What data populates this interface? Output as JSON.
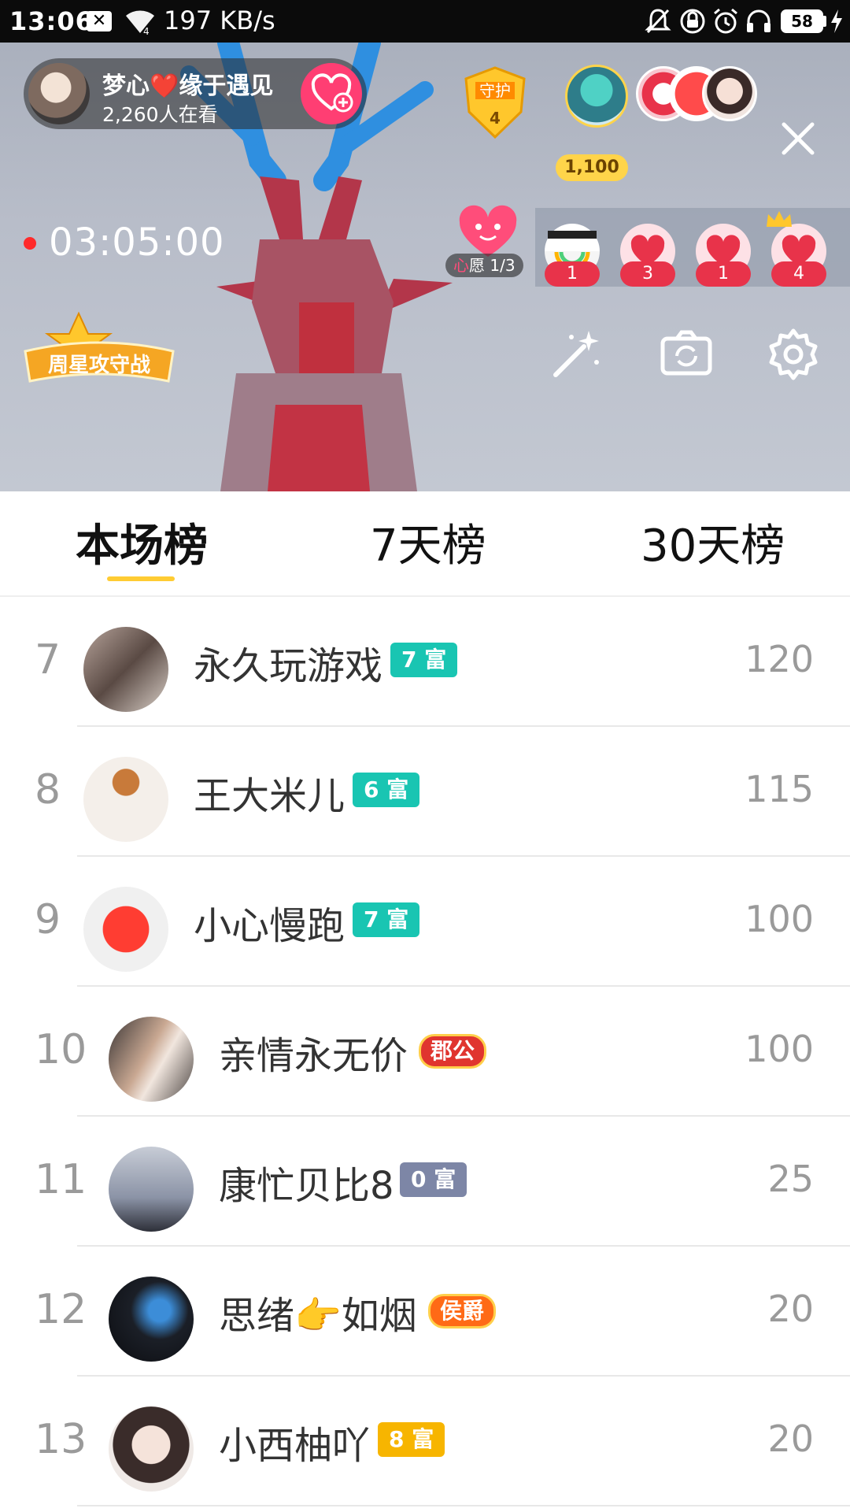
{
  "status_bar": {
    "time": "13:06",
    "notification_badge": "✕",
    "net_speed": "197 KB/s",
    "battery": "58",
    "icons": [
      "mute-icon",
      "lock-rotation-icon",
      "alarm-icon",
      "headset-icon",
      "charging-icon"
    ]
  },
  "live": {
    "host_name": "梦心❤️缘于遇见",
    "viewers": "2,260人在看",
    "guard_label": "守护",
    "guard_count": "4",
    "coins": "1,100",
    "duration": "03:05:00",
    "wish_prefix": "心",
    "wish_text": "愿 1/3",
    "gifts": [
      {
        "count": "1"
      },
      {
        "count": "3"
      },
      {
        "count": "1"
      },
      {
        "count": "4"
      }
    ],
    "event_banner": "周星攻守战",
    "accent_color": "#ff3e73"
  },
  "tabs": [
    {
      "label": "本场榜",
      "active": true
    },
    {
      "label": "7天榜",
      "active": false
    },
    {
      "label": "30天榜",
      "active": false
    }
  ],
  "ranking": [
    {
      "rank": "7",
      "name": "永久玩游戏",
      "badge": "7 富",
      "badge_style": "teal",
      "score": "120"
    },
    {
      "rank": "8",
      "name": "王大米儿",
      "badge": "6 富",
      "badge_style": "teal",
      "score": "115"
    },
    {
      "rank": "9",
      "name": "小心慢跑",
      "badge": "7 富",
      "badge_style": "teal",
      "score": "100"
    },
    {
      "rank": "10",
      "name": "亲情永无价",
      "badge": "郡公",
      "badge_style": "noble-red",
      "score": "100"
    },
    {
      "rank": "11",
      "name": "康忙贝比8",
      "badge": "0 富",
      "badge_style": "slate",
      "score": "25"
    },
    {
      "rank": "12",
      "name": "思绪👉如烟",
      "badge": "侯爵",
      "badge_style": "noble-orange",
      "score": "20"
    },
    {
      "rank": "13",
      "name": "小西柚吖",
      "badge": "8 富",
      "badge_style": "gold",
      "score": "20"
    }
  ]
}
